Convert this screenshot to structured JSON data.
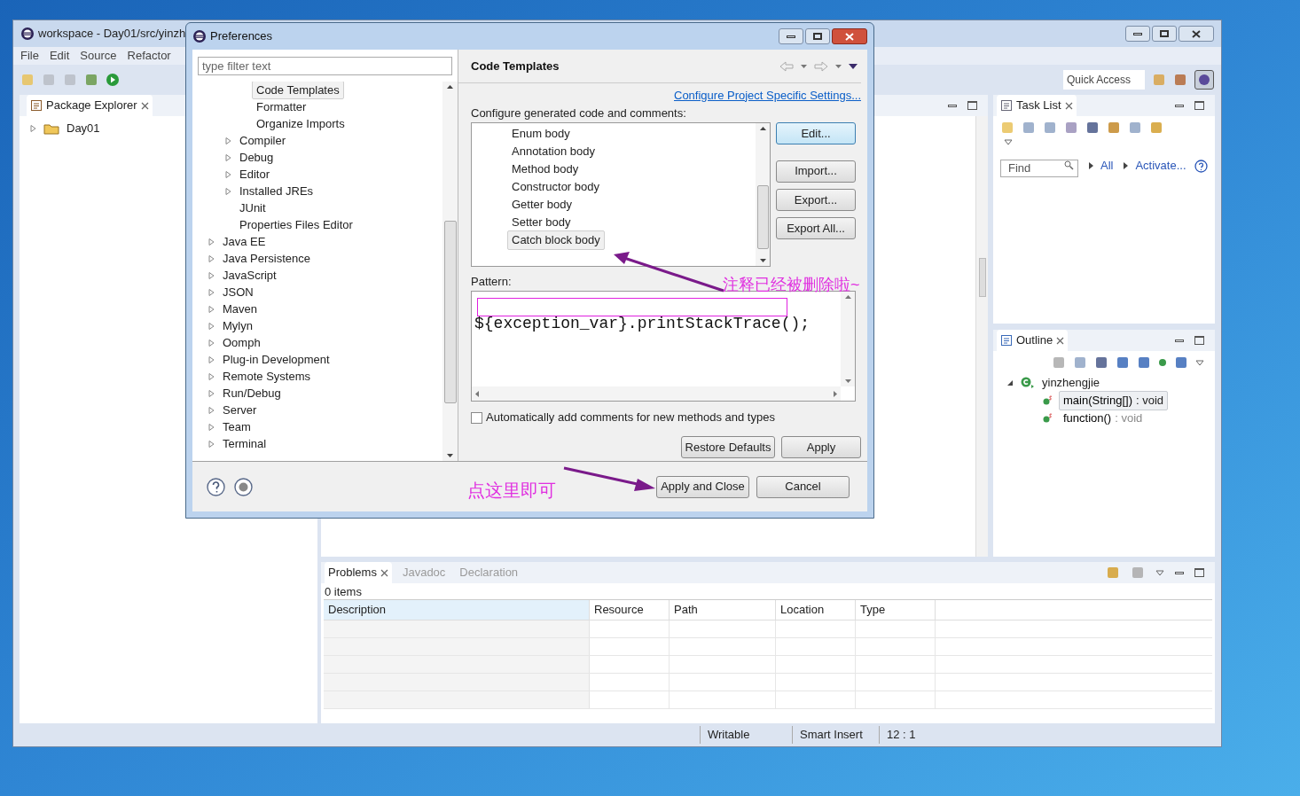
{
  "workbench": {
    "title": "workspace - Day01/src/yinzh",
    "menu": [
      "File",
      "Edit",
      "Source",
      "Refactor"
    ],
    "quick_access": {
      "placeholder": "Quick Access"
    }
  },
  "package_explorer": {
    "title": "Package Explorer",
    "tree": [
      {
        "label": "Day01",
        "expanded": false
      }
    ]
  },
  "task_list": {
    "title": "Task List",
    "find": {
      "placeholder": "Find"
    },
    "links": [
      "All",
      "Activate..."
    ]
  },
  "outline": {
    "title": "Outline",
    "tree": [
      {
        "label": "yinzhengjie",
        "expanded": true,
        "children": [
          {
            "name": "main(String[])",
            "type": ": void",
            "selected": true
          },
          {
            "name": "function()",
            "type": ": void",
            "selected": false
          }
        ]
      }
    ]
  },
  "bottom_panel": {
    "tabs": [
      {
        "label": "Problems",
        "selected": true
      },
      {
        "label": "Javadoc",
        "selected": false
      },
      {
        "label": "Declaration",
        "selected": false
      }
    ],
    "count": "0 items",
    "columns": [
      "Description",
      "Resource",
      "Path",
      "Location",
      "Type"
    ]
  },
  "status_bar": [
    "Writable",
    "Smart Insert",
    "12 : 1"
  ],
  "preferences": {
    "title": "Preferences",
    "filter": {
      "placeholder": "type filter text"
    },
    "tree": [
      {
        "children": [
          {
            "children": [
              {
                "label": "Code Templates",
                "expandable": false,
                "selected": true
              },
              {
                "label": "Formatter",
                "expandable": false,
                "selected": false
              },
              {
                "label": "Organize Imports",
                "expandable": false,
                "selected": false
              }
            ]
          },
          {
            "label": "Compiler",
            "expandable": true,
            "selected": false
          },
          {
            "label": "Debug",
            "expandable": true,
            "selected": false
          },
          {
            "label": "Editor",
            "expandable": true,
            "selected": false
          },
          {
            "label": "Installed JREs",
            "expandable": true,
            "selected": false
          },
          {
            "label": "JUnit",
            "expandable": false,
            "selected": false
          },
          {
            "label": "Properties Files Editor",
            "expandable": false,
            "selected": false
          }
        ]
      },
      {
        "label": "Java EE",
        "expandable": true,
        "selected": false
      },
      {
        "label": "Java Persistence",
        "expandable": true,
        "selected": false
      },
      {
        "label": "JavaScript",
        "expandable": true,
        "selected": false
      },
      {
        "label": "JSON",
        "expandable": true,
        "selected": false
      },
      {
        "label": "Maven",
        "expandable": true,
        "selected": false
      },
      {
        "label": "Mylyn",
        "expandable": true,
        "selected": false
      },
      {
        "label": "Oomph",
        "expandable": true,
        "selected": false
      },
      {
        "label": "Plug-in Development",
        "expandable": true,
        "selected": false
      },
      {
        "label": "Remote Systems",
        "expandable": true,
        "selected": false
      },
      {
        "label": "Run/Debug",
        "expandable": true,
        "selected": false
      },
      {
        "label": "Server",
        "expandable": true,
        "selected": false
      },
      {
        "label": "Team",
        "expandable": true,
        "selected": false
      },
      {
        "label": "Terminal",
        "expandable": true,
        "selected": false
      }
    ],
    "page_title": "Code Templates",
    "link": "Configure Project Specific Settings...",
    "description": "Configure generated code and comments:",
    "templates": [
      {
        "label": "Enum body",
        "selected": false
      },
      {
        "label": "Annotation body",
        "selected": false
      },
      {
        "label": "Method body",
        "selected": false
      },
      {
        "label": "Constructor body",
        "selected": false
      },
      {
        "label": "Getter body",
        "selected": false
      },
      {
        "label": "Setter body",
        "selected": false
      },
      {
        "label": "Catch block body",
        "selected": true
      }
    ],
    "template_buttons": [
      {
        "label": "Edit...",
        "focused": true
      },
      {
        "label": "Import...",
        "focused": false
      },
      {
        "label": "Export...",
        "focused": false
      },
      {
        "label": "Export All...",
        "focused": false
      }
    ],
    "pattern_label": "Pattern:",
    "pattern": "${exception_var}.printStackTrace();",
    "auto_comments": {
      "label": "Automatically add comments for new methods and types",
      "checked": false
    },
    "page_buttons": [
      "Restore Defaults",
      "Apply"
    ],
    "dialog_buttons": [
      "Apply and Close",
      "Cancel"
    ]
  },
  "annotations": [
    "注释已经被删除啦~",
    "点这里即可"
  ]
}
